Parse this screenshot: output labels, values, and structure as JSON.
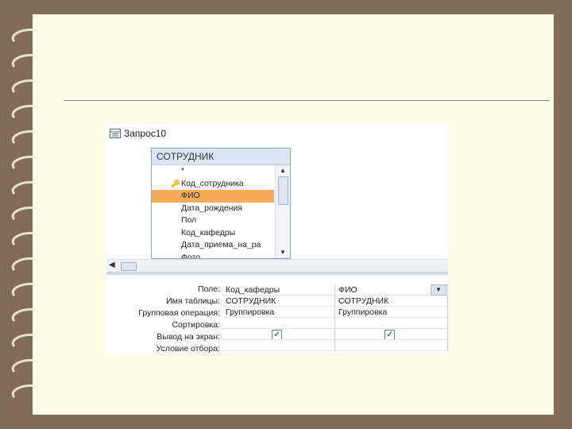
{
  "query": {
    "title": "Запрос10",
    "table": {
      "name": "СОТРУДНИК",
      "fields": [
        "*",
        "Код_сотрудника",
        "ФИО",
        "Дата_рождения",
        "Пол",
        "Код_кафедры",
        "Дата_приема_на_ра",
        "Фото"
      ],
      "selected_field": "ФИО",
      "key_field": "Код_сотрудника"
    },
    "grid": {
      "row_labels": [
        "Поле:",
        "Имя таблицы:",
        "Групповая операция:",
        "Сортировка:",
        "Вывод на экран:",
        "Условие отбора:"
      ],
      "col1": {
        "field": "Код_кафедры",
        "table": "СОТРУДНИК",
        "group": "Группировка",
        "sort": "",
        "show": true,
        "criteria": ""
      },
      "col2": {
        "field": "ФИО",
        "table": "СОТРУДНИК",
        "group": "Группировка",
        "sort": "",
        "show": true,
        "criteria": ""
      },
      "checkmark": "✓"
    }
  },
  "icons": [
    "query-icon",
    "key-icon",
    "scroll-up-icon",
    "scroll-down-icon",
    "scroll-left-icon",
    "dropdown-icon",
    "checkbox-icon"
  ]
}
